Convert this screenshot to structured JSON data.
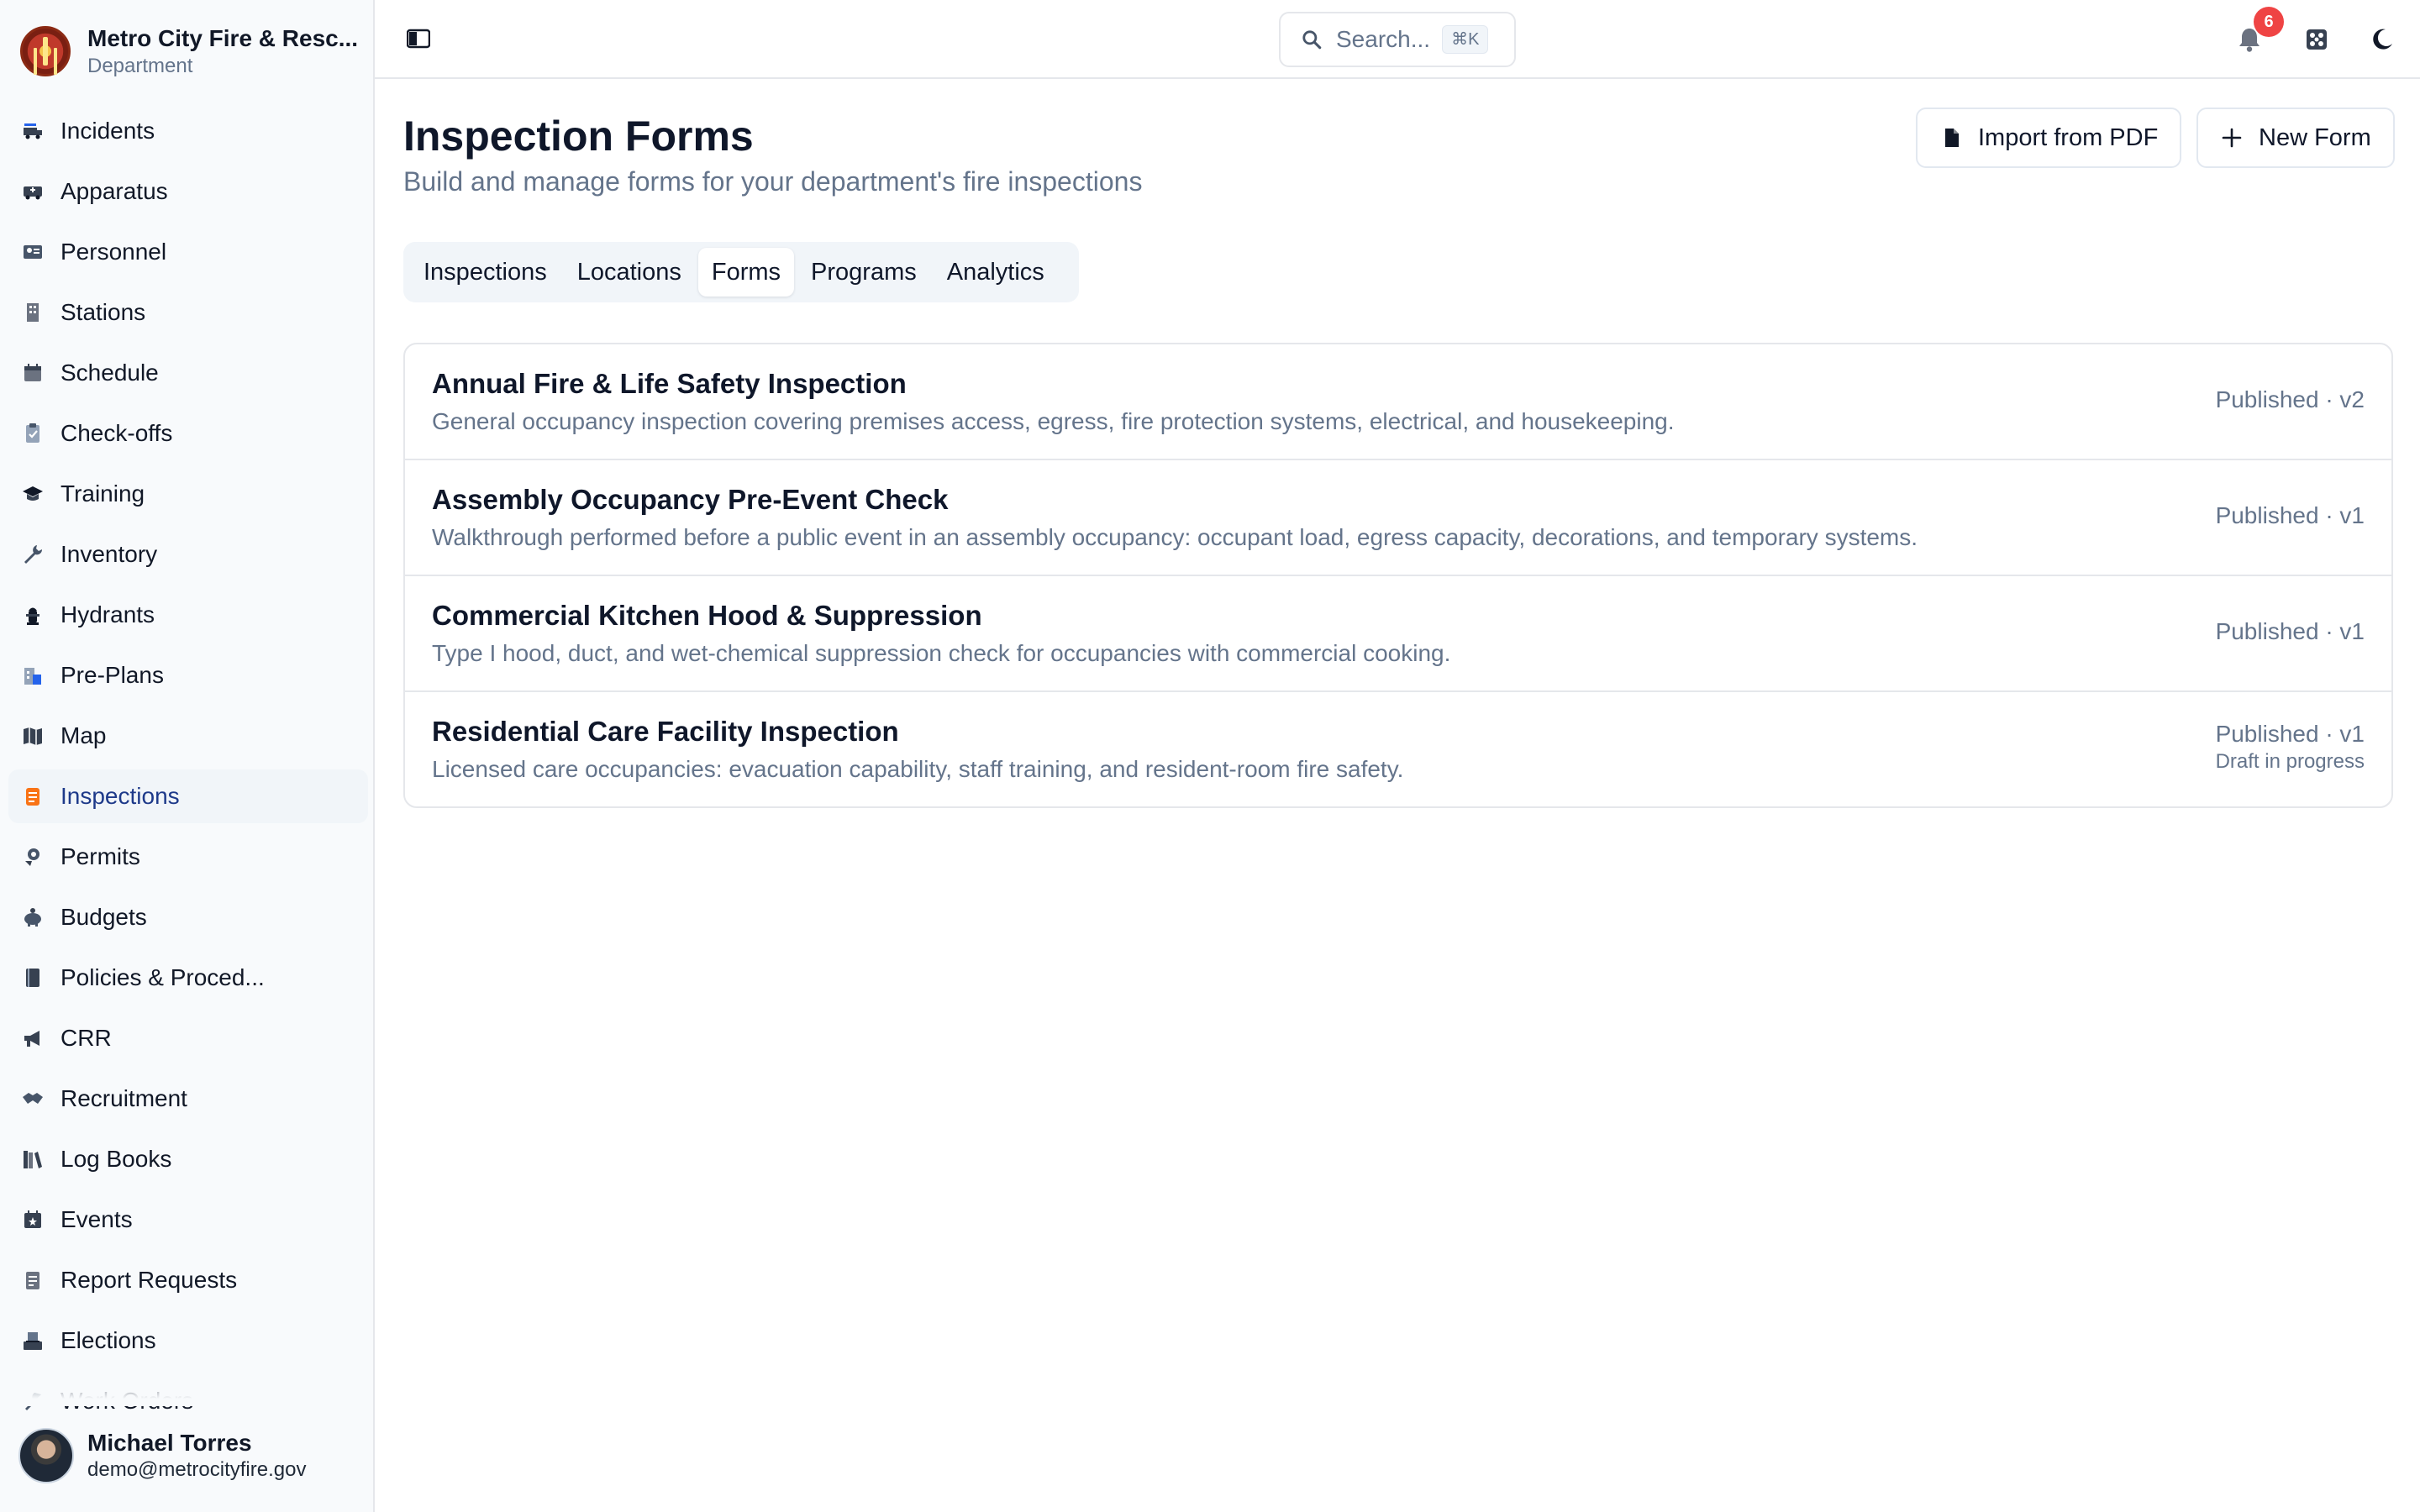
{
  "org": {
    "name": "Metro City Fire & Resc...",
    "subtitle": "Department"
  },
  "sidebar": {
    "items": [
      {
        "label": "Incidents",
        "icon": "fire-truck-icon"
      },
      {
        "label": "Apparatus",
        "icon": "ambulance-icon"
      },
      {
        "label": "Personnel",
        "icon": "id-card-icon"
      },
      {
        "label": "Stations",
        "icon": "building-icon"
      },
      {
        "label": "Schedule",
        "icon": "calendar-icon"
      },
      {
        "label": "Check-offs",
        "icon": "clipboard-check-icon"
      },
      {
        "label": "Training",
        "icon": "graduation-cap-icon"
      },
      {
        "label": "Inventory",
        "icon": "wrench-icon"
      },
      {
        "label": "Hydrants",
        "icon": "hydrant-icon"
      },
      {
        "label": "Pre-Plans",
        "icon": "building-plan-icon"
      },
      {
        "label": "Map",
        "icon": "map-icon"
      },
      {
        "label": "Inspections",
        "icon": "inspection-icon",
        "active": true
      },
      {
        "label": "Permits",
        "icon": "permit-icon"
      },
      {
        "label": "Budgets",
        "icon": "piggy-bank-icon"
      },
      {
        "label": "Policies & Proced...",
        "icon": "book-icon"
      },
      {
        "label": "CRR",
        "icon": "megaphone-icon"
      },
      {
        "label": "Recruitment",
        "icon": "handshake-icon"
      },
      {
        "label": "Log Books",
        "icon": "books-icon"
      },
      {
        "label": "Events",
        "icon": "calendar-star-icon"
      },
      {
        "label": "Report Requests",
        "icon": "report-icon"
      },
      {
        "label": "Elections",
        "icon": "ballot-box-icon"
      },
      {
        "label": "Work Orders",
        "icon": "tools-icon"
      }
    ]
  },
  "user": {
    "name": "Michael Torres",
    "email": "demo@metrocityfire.gov"
  },
  "topbar": {
    "search_placeholder": "Search...",
    "search_shortcut": "⌘K",
    "notification_count": "6"
  },
  "page": {
    "title": "Inspection Forms",
    "subtitle": "Build and manage forms for your department's fire inspections",
    "import_label": "Import from PDF",
    "new_label": "New Form"
  },
  "tabs": [
    {
      "label": "Inspections"
    },
    {
      "label": "Locations"
    },
    {
      "label": "Forms",
      "active": true
    },
    {
      "label": "Programs"
    },
    {
      "label": "Analytics"
    }
  ],
  "forms": [
    {
      "title": "Annual Fire & Life Safety Inspection",
      "description": "General occupancy inspection covering premises access, egress, fire protection systems, electrical, and housekeeping.",
      "status": "Published · v2",
      "draft": ""
    },
    {
      "title": "Assembly Occupancy Pre-Event Check",
      "description": "Walkthrough performed before a public event in an assembly occupancy: occupant load, egress capacity, decorations, and temporary systems.",
      "status": "Published · v1",
      "draft": ""
    },
    {
      "title": "Commercial Kitchen Hood & Suppression",
      "description": "Type I hood, duct, and wet-chemical suppression check for occupancies with commercial cooking.",
      "status": "Published · v1",
      "draft": ""
    },
    {
      "title": "Residential Care Facility Inspection",
      "description": "Licensed care occupancies: evacuation capability, staff training, and resident-room fire safety.",
      "status": "Published · v1",
      "draft": "Draft in progress"
    }
  ],
  "colors": {
    "accent": "#1e3a8a",
    "inspection_icon": "#f97316",
    "badge": "#ef4444",
    "muted_text": "#64748b"
  }
}
